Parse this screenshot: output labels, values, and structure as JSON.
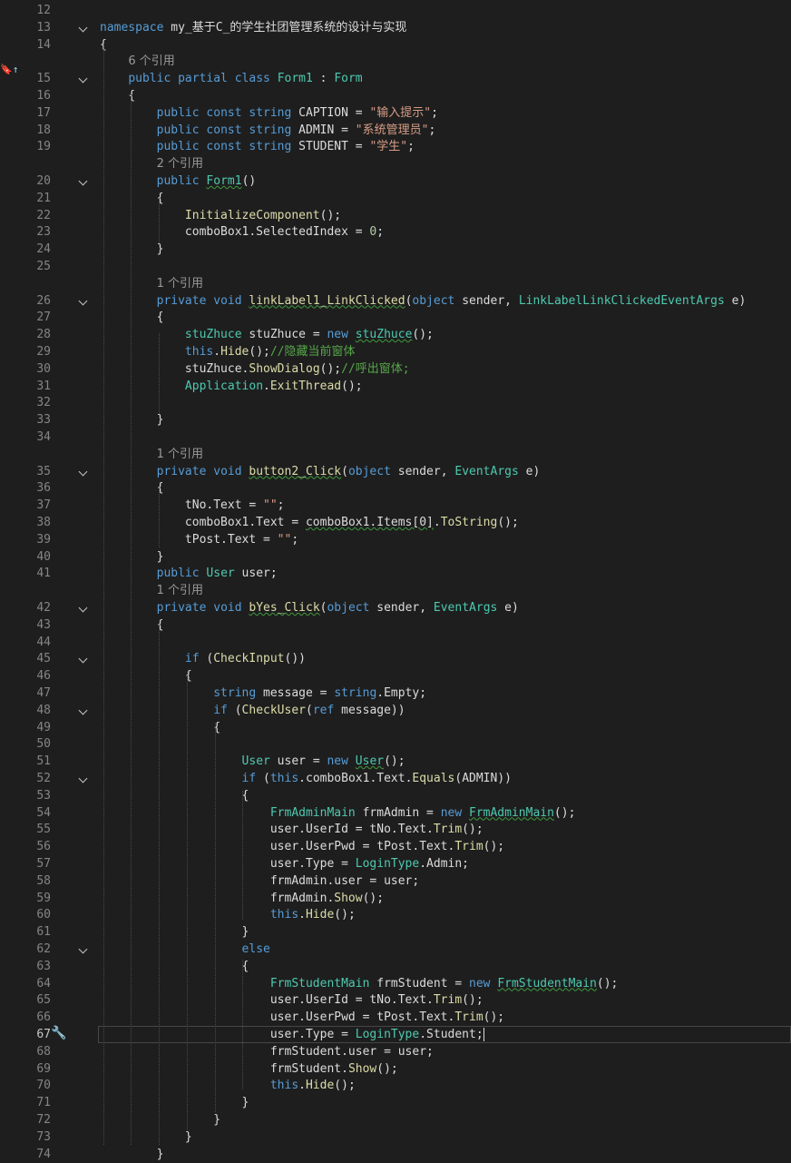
{
  "editor": {
    "left_marker": "🔖↑",
    "quick_action": "🔧",
    "current_line": "67",
    "lines": [
      {
        "n": "12",
        "fold": false,
        "tokens": []
      },
      {
        "n": "13",
        "fold": true,
        "tokens": [
          [
            "kw",
            "namespace"
          ],
          [
            "pl",
            " my_基于C_的学生社团管理系统的设计与实现"
          ]
        ]
      },
      {
        "n": "14",
        "fold": false,
        "tokens": [
          [
            "pl",
            "{"
          ]
        ]
      },
      {
        "n": "",
        "fold": false,
        "tokens": [
          [
            "pl",
            "    "
          ],
          [
            "ref",
            "6 个引用"
          ]
        ]
      },
      {
        "n": "15",
        "fold": true,
        "tokens": [
          [
            "pl",
            "    "
          ],
          [
            "kw",
            "public partial class "
          ],
          [
            "ty",
            "Form1"
          ],
          [
            "pl",
            " : "
          ],
          [
            "ty",
            "Form"
          ]
        ]
      },
      {
        "n": "16",
        "fold": false,
        "tokens": [
          [
            "pl",
            "    {"
          ]
        ]
      },
      {
        "n": "17",
        "fold": false,
        "tokens": [
          [
            "pl",
            "        "
          ],
          [
            "kw",
            "public const string "
          ],
          [
            "pl",
            "CAPTION = "
          ],
          [
            "str",
            "\"输入提示\""
          ],
          [
            "pl",
            ";"
          ]
        ]
      },
      {
        "n": "18",
        "fold": false,
        "tokens": [
          [
            "pl",
            "        "
          ],
          [
            "kw",
            "public const string "
          ],
          [
            "pl",
            "ADMIN = "
          ],
          [
            "str",
            "\"系统管理员\""
          ],
          [
            "pl",
            ";"
          ]
        ]
      },
      {
        "n": "19",
        "fold": false,
        "tokens": [
          [
            "pl",
            "        "
          ],
          [
            "kw",
            "public const string "
          ],
          [
            "pl",
            "STUDENT = "
          ],
          [
            "str",
            "\"学生\""
          ],
          [
            "pl",
            ";"
          ]
        ]
      },
      {
        "n": "",
        "fold": false,
        "tokens": [
          [
            "pl",
            "        "
          ],
          [
            "ref",
            "2 个引用"
          ]
        ]
      },
      {
        "n": "20",
        "fold": true,
        "tokens": [
          [
            "pl",
            "        "
          ],
          [
            "kw",
            "public "
          ],
          [
            "ty squig",
            "Form1"
          ],
          [
            "pl",
            "()"
          ]
        ]
      },
      {
        "n": "21",
        "fold": false,
        "tokens": [
          [
            "pl",
            "        {"
          ]
        ]
      },
      {
        "n": "22",
        "fold": false,
        "tokens": [
          [
            "pl",
            "            "
          ],
          [
            "mth",
            "InitializeComponent"
          ],
          [
            "pl",
            "();"
          ]
        ]
      },
      {
        "n": "23",
        "fold": false,
        "tokens": [
          [
            "pl",
            "            comboBox1.SelectedIndex = "
          ],
          [
            "num",
            "0"
          ],
          [
            "pl",
            ";"
          ]
        ]
      },
      {
        "n": "24",
        "fold": false,
        "tokens": [
          [
            "pl",
            "        }"
          ]
        ]
      },
      {
        "n": "25",
        "fold": false,
        "tokens": []
      },
      {
        "n": "",
        "fold": false,
        "tokens": [
          [
            "pl",
            "        "
          ],
          [
            "ref",
            "1 个引用"
          ]
        ]
      },
      {
        "n": "26",
        "fold": true,
        "tokens": [
          [
            "pl",
            "        "
          ],
          [
            "kw",
            "private void "
          ],
          [
            "mth squig",
            "linkLabel1_LinkClicked"
          ],
          [
            "pl",
            "("
          ],
          [
            "kw",
            "object "
          ],
          [
            "pl",
            "sender, "
          ],
          [
            "ty",
            "LinkLabelLinkClickedEventArgs"
          ],
          [
            "pl",
            " e)"
          ]
        ]
      },
      {
        "n": "27",
        "fold": false,
        "tokens": [
          [
            "pl",
            "        {"
          ]
        ]
      },
      {
        "n": "28",
        "fold": false,
        "tokens": [
          [
            "pl",
            "            "
          ],
          [
            "ty",
            "stuZhuce"
          ],
          [
            "pl",
            " stuZhuce = "
          ],
          [
            "kw",
            "new "
          ],
          [
            "ty squig",
            "stuZhuce"
          ],
          [
            "pl",
            "();"
          ]
        ]
      },
      {
        "n": "29",
        "fold": false,
        "tokens": [
          [
            "pl",
            "            "
          ],
          [
            "kw",
            "this"
          ],
          [
            "pl",
            "."
          ],
          [
            "mth",
            "Hide"
          ],
          [
            "pl",
            "();"
          ],
          [
            "cmt",
            "//隐藏当前窗体"
          ]
        ]
      },
      {
        "n": "30",
        "fold": false,
        "tokens": [
          [
            "pl",
            "            stuZhuce."
          ],
          [
            "mth",
            "ShowDialog"
          ],
          [
            "pl",
            "();"
          ],
          [
            "cmt",
            "//呼出窗体;"
          ]
        ]
      },
      {
        "n": "31",
        "fold": false,
        "tokens": [
          [
            "pl",
            "            "
          ],
          [
            "ty",
            "Application"
          ],
          [
            "pl",
            "."
          ],
          [
            "mth",
            "ExitThread"
          ],
          [
            "pl",
            "();"
          ]
        ]
      },
      {
        "n": "32",
        "fold": false,
        "tokens": []
      },
      {
        "n": "33",
        "fold": false,
        "tokens": [
          [
            "pl",
            "        }"
          ]
        ]
      },
      {
        "n": "34",
        "fold": false,
        "tokens": []
      },
      {
        "n": "",
        "fold": false,
        "tokens": [
          [
            "pl",
            "        "
          ],
          [
            "ref",
            "1 个引用"
          ]
        ]
      },
      {
        "n": "35",
        "fold": true,
        "tokens": [
          [
            "pl",
            "        "
          ],
          [
            "kw",
            "private void "
          ],
          [
            "mth squig",
            "button2_Click"
          ],
          [
            "pl",
            "("
          ],
          [
            "kw",
            "object "
          ],
          [
            "pl",
            "sender, "
          ],
          [
            "ty",
            "EventArgs"
          ],
          [
            "pl",
            " e)"
          ]
        ]
      },
      {
        "n": "36",
        "fold": false,
        "tokens": [
          [
            "pl",
            "        {"
          ]
        ]
      },
      {
        "n": "37",
        "fold": false,
        "tokens": [
          [
            "pl",
            "            tNo.Text = "
          ],
          [
            "str",
            "\"\""
          ],
          [
            "pl",
            ";"
          ]
        ]
      },
      {
        "n": "38",
        "fold": false,
        "tokens": [
          [
            "pl",
            "            comboBox1.Text = "
          ],
          [
            "pl squig",
            "comboBox1.Items[0]"
          ],
          [
            "pl",
            "."
          ],
          [
            "mth",
            "ToString"
          ],
          [
            "pl",
            "();"
          ]
        ]
      },
      {
        "n": "39",
        "fold": false,
        "tokens": [
          [
            "pl",
            "            tPost.Text = "
          ],
          [
            "str",
            "\"\""
          ],
          [
            "pl",
            ";"
          ]
        ]
      },
      {
        "n": "40",
        "fold": false,
        "tokens": [
          [
            "pl",
            "        }"
          ]
        ]
      },
      {
        "n": "41",
        "fold": false,
        "tokens": [
          [
            "pl",
            "        "
          ],
          [
            "kw",
            "public "
          ],
          [
            "ty",
            "User"
          ],
          [
            "pl",
            " user;"
          ]
        ]
      },
      {
        "n": "",
        "fold": false,
        "tokens": [
          [
            "pl",
            "        "
          ],
          [
            "ref",
            "1 个引用"
          ]
        ]
      },
      {
        "n": "42",
        "fold": true,
        "tokens": [
          [
            "pl",
            "        "
          ],
          [
            "kw",
            "private void "
          ],
          [
            "mth squig",
            "bYes_Click"
          ],
          [
            "pl",
            "("
          ],
          [
            "kw",
            "object "
          ],
          [
            "pl",
            "sender, "
          ],
          [
            "ty",
            "EventArgs"
          ],
          [
            "pl",
            " e)"
          ]
        ]
      },
      {
        "n": "43",
        "fold": false,
        "tokens": [
          [
            "pl",
            "        {"
          ]
        ]
      },
      {
        "n": "44",
        "fold": false,
        "tokens": []
      },
      {
        "n": "45",
        "fold": true,
        "tokens": [
          [
            "pl",
            "            "
          ],
          [
            "kw",
            "if "
          ],
          [
            "pl",
            "("
          ],
          [
            "mth",
            "CheckInput"
          ],
          [
            "pl",
            "())"
          ]
        ]
      },
      {
        "n": "46",
        "fold": false,
        "tokens": [
          [
            "pl",
            "            {"
          ]
        ]
      },
      {
        "n": "47",
        "fold": false,
        "tokens": [
          [
            "pl",
            "                "
          ],
          [
            "kw",
            "string "
          ],
          [
            "pl",
            "message = "
          ],
          [
            "kw",
            "string"
          ],
          [
            "pl",
            "."
          ],
          [
            "pl",
            "Empty;"
          ]
        ]
      },
      {
        "n": "48",
        "fold": true,
        "tokens": [
          [
            "pl",
            "                "
          ],
          [
            "kw",
            "if "
          ],
          [
            "pl",
            "("
          ],
          [
            "mth",
            "CheckUser"
          ],
          [
            "pl",
            "("
          ],
          [
            "kw",
            "ref "
          ],
          [
            "pl",
            "message))"
          ]
        ]
      },
      {
        "n": "49",
        "fold": false,
        "tokens": [
          [
            "pl",
            "                {"
          ]
        ]
      },
      {
        "n": "50",
        "fold": false,
        "tokens": []
      },
      {
        "n": "51",
        "fold": false,
        "tokens": [
          [
            "pl",
            "                    "
          ],
          [
            "ty",
            "User"
          ],
          [
            "pl",
            " user = "
          ],
          [
            "kw",
            "new "
          ],
          [
            "ty squig",
            "User"
          ],
          [
            "pl",
            "();"
          ]
        ]
      },
      {
        "n": "52",
        "fold": true,
        "tokens": [
          [
            "pl",
            "                    "
          ],
          [
            "kw",
            "if "
          ],
          [
            "pl",
            "("
          ],
          [
            "kw",
            "this"
          ],
          [
            "pl",
            ".comboBox1.Text."
          ],
          [
            "mth",
            "Equals"
          ],
          [
            "pl",
            "(ADMIN))"
          ]
        ]
      },
      {
        "n": "53",
        "fold": false,
        "tokens": [
          [
            "pl",
            "                    {"
          ]
        ]
      },
      {
        "n": "54",
        "fold": false,
        "tokens": [
          [
            "pl",
            "                        "
          ],
          [
            "ty",
            "FrmAdminMain"
          ],
          [
            "pl",
            " frmAdmin = "
          ],
          [
            "kw",
            "new "
          ],
          [
            "ty squig",
            "FrmAdminMain"
          ],
          [
            "pl",
            "();"
          ]
        ]
      },
      {
        "n": "55",
        "fold": false,
        "tokens": [
          [
            "pl",
            "                        user.UserId = tNo.Text."
          ],
          [
            "mth",
            "Trim"
          ],
          [
            "pl",
            "();"
          ]
        ]
      },
      {
        "n": "56",
        "fold": false,
        "tokens": [
          [
            "pl",
            "                        user.UserPwd = tPost.Text."
          ],
          [
            "mth",
            "Trim"
          ],
          [
            "pl",
            "();"
          ]
        ]
      },
      {
        "n": "57",
        "fold": false,
        "tokens": [
          [
            "pl",
            "                        user.Type = "
          ],
          [
            "ty",
            "LoginType"
          ],
          [
            "pl",
            ".Admin;"
          ]
        ]
      },
      {
        "n": "58",
        "fold": false,
        "tokens": [
          [
            "pl",
            "                        frmAdmin.user = user;"
          ]
        ]
      },
      {
        "n": "59",
        "fold": false,
        "tokens": [
          [
            "pl",
            "                        frmAdmin."
          ],
          [
            "mth",
            "Show"
          ],
          [
            "pl",
            "();"
          ]
        ]
      },
      {
        "n": "60",
        "fold": false,
        "tokens": [
          [
            "pl",
            "                        "
          ],
          [
            "kw",
            "this"
          ],
          [
            "pl",
            "."
          ],
          [
            "mth",
            "Hide"
          ],
          [
            "pl",
            "();"
          ]
        ]
      },
      {
        "n": "61",
        "fold": false,
        "tokens": [
          [
            "pl",
            "                    }"
          ]
        ]
      },
      {
        "n": "62",
        "fold": true,
        "tokens": [
          [
            "pl",
            "                    "
          ],
          [
            "kw",
            "else"
          ]
        ]
      },
      {
        "n": "63",
        "fold": false,
        "tokens": [
          [
            "pl",
            "                    {"
          ]
        ]
      },
      {
        "n": "64",
        "fold": false,
        "tokens": [
          [
            "pl",
            "                        "
          ],
          [
            "ty",
            "FrmStudentMain"
          ],
          [
            "pl",
            " frmStudent = "
          ],
          [
            "kw",
            "new "
          ],
          [
            "ty squig",
            "FrmStudentMain"
          ],
          [
            "pl",
            "();"
          ]
        ]
      },
      {
        "n": "65",
        "fold": false,
        "tokens": [
          [
            "pl",
            "                        user.UserId = tNo.Text."
          ],
          [
            "mth",
            "Trim"
          ],
          [
            "pl",
            "();"
          ]
        ]
      },
      {
        "n": "66",
        "fold": false,
        "tokens": [
          [
            "pl",
            "                        user.UserPwd = tPost.Text."
          ],
          [
            "mth",
            "Trim"
          ],
          [
            "pl",
            "();"
          ]
        ]
      },
      {
        "n": "67",
        "fold": false,
        "tokens": [
          [
            "pl",
            "                        user.Type = "
          ],
          [
            "ty",
            "LoginType"
          ],
          [
            "pl",
            ".Student;"
          ]
        ]
      },
      {
        "n": "68",
        "fold": false,
        "tokens": [
          [
            "pl",
            "                        frmStudent.user = user;"
          ]
        ]
      },
      {
        "n": "69",
        "fold": false,
        "tokens": [
          [
            "pl",
            "                        frmStudent."
          ],
          [
            "mth",
            "Show"
          ],
          [
            "pl",
            "();"
          ]
        ]
      },
      {
        "n": "70",
        "fold": false,
        "tokens": [
          [
            "pl",
            "                        "
          ],
          [
            "kw",
            "this"
          ],
          [
            "pl",
            "."
          ],
          [
            "mth",
            "Hide"
          ],
          [
            "pl",
            "();"
          ]
        ]
      },
      {
        "n": "71",
        "fold": false,
        "tokens": [
          [
            "pl",
            "                    }"
          ]
        ]
      },
      {
        "n": "72",
        "fold": false,
        "tokens": [
          [
            "pl",
            "                }"
          ]
        ]
      },
      {
        "n": "73",
        "fold": false,
        "tokens": [
          [
            "pl",
            "            }"
          ]
        ]
      },
      {
        "n": "74",
        "fold": false,
        "tokens": [
          [
            "pl",
            "        }"
          ]
        ]
      }
    ]
  }
}
